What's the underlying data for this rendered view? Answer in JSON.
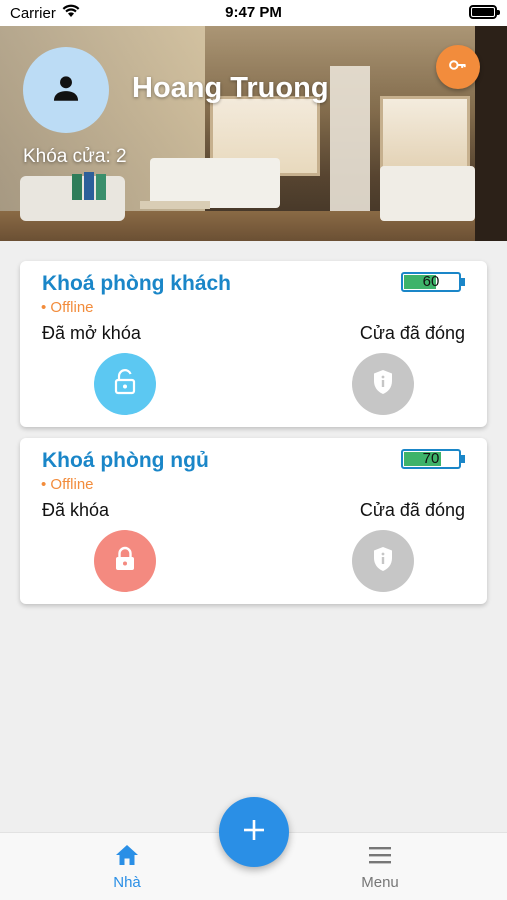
{
  "status_bar": {
    "carrier": "Carrier",
    "time": "9:47 PM"
  },
  "header": {
    "user_name": "Hoang Truong",
    "lock_count_label": "Khóa cửa: 2"
  },
  "locks": [
    {
      "title": "Khoá phòng khách",
      "status": "• Offline",
      "lock_state": "Đã mở khóa",
      "door_state": "Cửa đã đóng",
      "battery": "60",
      "battery_level": 0.6,
      "lock_color": "#5cc8f2",
      "lock_icon": "unlocked-padlock-icon"
    },
    {
      "title": "Khoá phòng ngủ",
      "status": "• Offline",
      "lock_state": "Đã khóa",
      "door_state": "Cửa đã đóng",
      "battery": "70",
      "battery_level": 0.7,
      "lock_color": "#f48a80",
      "lock_icon": "locked-padlock-icon"
    }
  ],
  "nav": {
    "home_label": "Nhà",
    "menu_label": "Menu"
  },
  "colors": {
    "accent": "#2a8fe6",
    "title": "#1a86c8",
    "offline": "#f28c3c",
    "battery_fill": "#3eb36a"
  }
}
